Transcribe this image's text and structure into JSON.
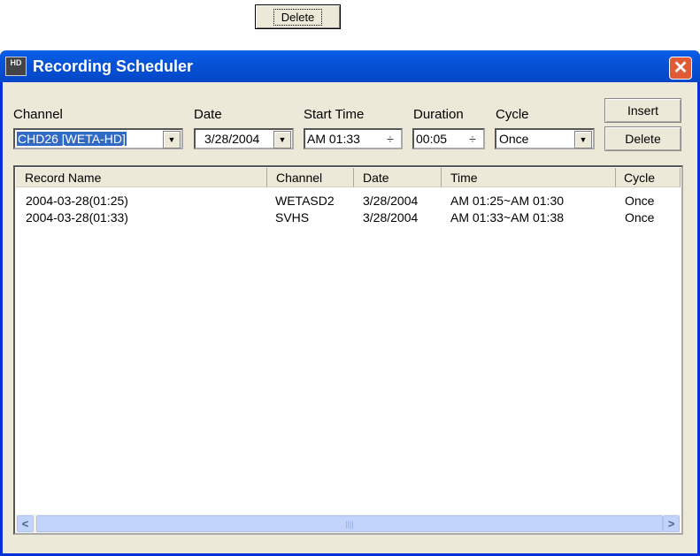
{
  "top_button": "Delete",
  "window": {
    "title": "Recording Scheduler",
    "logo_text": "HD"
  },
  "form": {
    "channel": {
      "label": "Channel",
      "value": "CHD26 [WETA-HD]"
    },
    "date": {
      "label": "Date",
      "value": "3/28/2004"
    },
    "start_time": {
      "label": "Start Time",
      "value": "AM 01:33"
    },
    "duration": {
      "label": "Duration",
      "value": "00:05"
    },
    "cycle": {
      "label": "Cycle",
      "value": "Once"
    },
    "insert_label": "Insert",
    "delete_label": "Delete"
  },
  "list": {
    "columns": [
      "Record Name",
      "Channel",
      "Date",
      "Time",
      "Cycle"
    ],
    "rows": [
      [
        "2004-03-28(01:25)",
        "WETASD2",
        "3/28/2004",
        "AM 01:25~AM 01:30",
        "Once"
      ],
      [
        "2004-03-28(01:33)",
        "SVHS",
        "3/28/2004",
        "AM 01:33~AM 01:38",
        "Once"
      ]
    ]
  }
}
